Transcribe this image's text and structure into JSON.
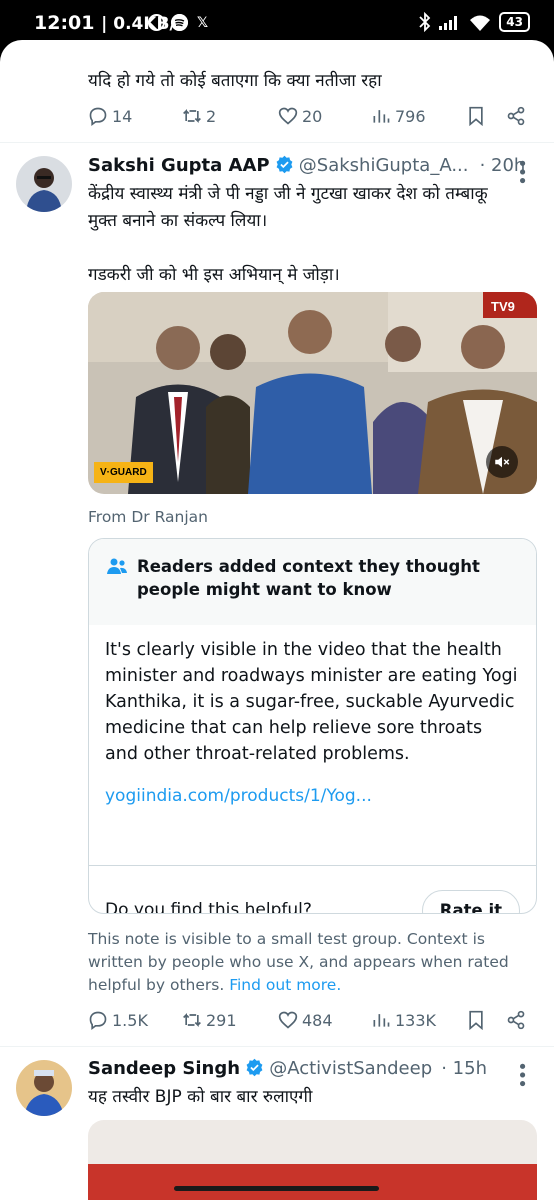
{
  "status_bar": {
    "time": "12:01",
    "speed": "| 0.4KB/s",
    "battery": "43"
  },
  "prev_tweet": {
    "text": "यदि हो गये तो कोई बताएगा कि क्या नतीजा रहा",
    "replies": "14",
    "reposts": "2",
    "likes": "20",
    "views": "796"
  },
  "tweet": {
    "name": "Sakshi Gupta AAP",
    "handle": "@SakshiGupta_A...",
    "time": "· 20h",
    "text_line1": "केंद्रीय स्वास्थ्य मंत्री जे पी नड्डा जी ने गुटखा खाकर देश को तम्बाकू",
    "text_line2": "मुक्त बनाने का संकल्प लिया।",
    "text_line3": "गडकरी जी को भी इस अभियान् मे जोड़ा।",
    "media_logo": "V·GUARD",
    "media_channel": "TV9",
    "from_label": "From Dr Ranjan",
    "replies": "1.5K",
    "reposts": "291",
    "likes": "484",
    "views": "133K"
  },
  "community_note": {
    "header": "Readers added context they thought people might want to know",
    "body": "It's clearly visible in the video that the health minister and roadways minister are eating Yogi Kanthika, it is a sugar-free, suckable Ayurvedic medicine that can help relieve sore throats and other throat-related problems.",
    "link": "yogiindia.com/products/1/Yog...",
    "question": "Do you find this helpful?",
    "rate_label": "Rate it",
    "disclaimer": "This note is visible to a small test group. Context is written by people who use X, and appears when rated helpful by others.",
    "find_out_more": "Find out more."
  },
  "next_tweet": {
    "name": "Sandeep Singh",
    "handle": "@ActivistSandeep",
    "time": "· 15h",
    "text": "यह तस्वीर BJP को बार बार रुलाएगी"
  },
  "colors": {
    "link": "#1d9bf0",
    "muted": "#536471",
    "text": "#0f1419"
  }
}
